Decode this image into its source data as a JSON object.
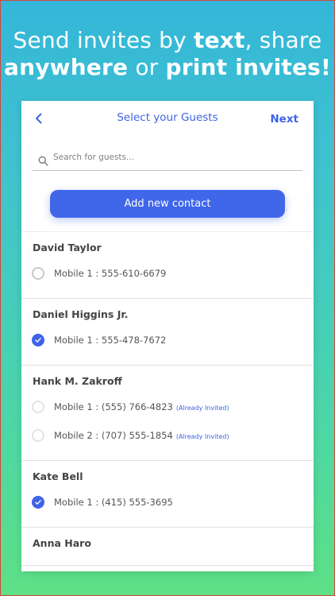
{
  "headline": {
    "line1_pre": "Send invites by ",
    "line1_bold": "text",
    "line1_post": ", share",
    "line2_bold1": "anywhere",
    "line2_mid": " or ",
    "line2_bold2": "print invites!"
  },
  "nav": {
    "title": "Select your Guests",
    "next_label": "Next"
  },
  "search": {
    "placeholder": "Search for guests..."
  },
  "add_contact_label": "Add new contact",
  "contacts": [
    {
      "name": "David Taylor",
      "phones": [
        {
          "label": "Mobile 1 : 555-610-6679",
          "selected": false,
          "invited": ""
        }
      ]
    },
    {
      "name": "Daniel Higgins Jr.",
      "phones": [
        {
          "label": "Mobile 1 : 555-478-7672",
          "selected": true,
          "invited": ""
        }
      ]
    },
    {
      "name": "Hank M. Zakroff",
      "phones": [
        {
          "label": "Mobile 1 : (555) 766-4823",
          "selected": false,
          "invited": "(Already Invited)"
        },
        {
          "label": "Mobile 2 : (707) 555-1854",
          "selected": false,
          "invited": "(Already Invited)"
        }
      ]
    },
    {
      "name": "Kate Bell",
      "phones": [
        {
          "label": "Mobile 1 : (415) 555-3695",
          "selected": true,
          "invited": ""
        }
      ]
    },
    {
      "name": "Anna Haro",
      "phones": []
    }
  ],
  "colors": {
    "accent": "#3e63e6",
    "gradient_top": "#34b6d9",
    "gradient_bottom": "#5ee085"
  }
}
